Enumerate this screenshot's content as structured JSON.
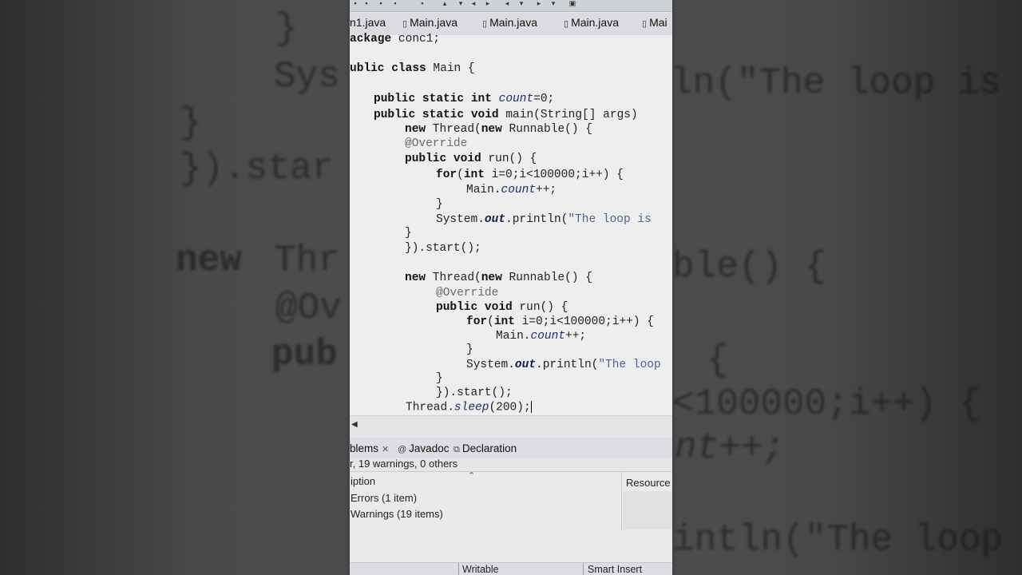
{
  "background": {
    "lines": [
      {
        "text": "}"
      },
      {
        "text": "Sys"
      },
      {
        "text": "ln(\"The loop is"
      },
      {
        "text": "}"
      },
      {
        "text": "}).star"
      },
      {
        "text": "new"
      },
      {
        "text": "Thr"
      },
      {
        "text": "ble() {"
      },
      {
        "text": "@Ov"
      },
      {
        "text": "pub"
      },
      {
        "text": "{"
      },
      {
        "text": "<100000;i++) {"
      },
      {
        "text": "nt++;"
      },
      {
        "text": "intln(\"The loop"
      }
    ]
  },
  "editor_tabs": [
    {
      "label": "n1.java"
    },
    {
      "label": "Main.java"
    },
    {
      "label": "Main.java"
    },
    {
      "label": "Main.java"
    },
    {
      "label": "Mai"
    }
  ],
  "code": {
    "l1_kw": "ackage",
    "l1_rest": " conc1;",
    "l2_kw": "ublic class",
    "l2_rest": " Main {",
    "l3_kw": "public static int",
    "l3_fld": "count",
    "l3_rest": "=0;",
    "l4_kw": "public static void",
    "l4_rest": " main(String[] args)",
    "l5_kw1": "new",
    "l5_mid": " Thread(",
    "l5_kw2": "new",
    "l5_rest": " Runnable() {",
    "l6_ann": "@Override",
    "l7_kw": "public void",
    "l7_rest": " run() {",
    "l8_kw1": "for",
    "l8_paren": "(",
    "l8_kw2": "int",
    "l8_rest": " i=0;i<100000;i++) {",
    "l9_pre": "Main.",
    "l9_fld": "count",
    "l9_rest": "++;",
    "l10": "}",
    "l11_pre": "System.",
    "l11_fld": "out",
    "l11_mid": ".println(",
    "l11_str": "\"The loop is",
    "l12": "}",
    "l13": "}).start();",
    "l14_kw1": "new",
    "l14_mid": " Thread(",
    "l14_kw2": "new",
    "l14_rest": " Runnable() {",
    "l15_ann": "@Override",
    "l16_kw": "public void",
    "l16_rest": " run() {",
    "l17_kw1": "for",
    "l17_paren": "(",
    "l17_kw2": "int",
    "l17_rest": " i=0;i<100000;i++) {",
    "l18_pre": "Main.",
    "l18_fld": "count",
    "l18_rest": "++;",
    "l19": "}",
    "l20_pre": "System.",
    "l20_fld": "out",
    "l20_mid": ".println(",
    "l20_str": "\"The loop",
    "l21": "}",
    "l22": "}).start();",
    "l23_pre": "Thread.",
    "l23_fld": "sleep",
    "l23_rest": "(200);"
  },
  "views": {
    "problems_tab": "blems",
    "javadoc_tab": "Javadoc",
    "declaration_tab": "Declaration",
    "summary": "r, 19 warnings, 0 others",
    "col_description": "iption",
    "col_resource": "Resource",
    "errors_item": "Errors (1 item)",
    "warnings_item": "Warnings (19 items)"
  },
  "status": {
    "writable": "Writable",
    "insert_mode": "Smart Insert"
  }
}
